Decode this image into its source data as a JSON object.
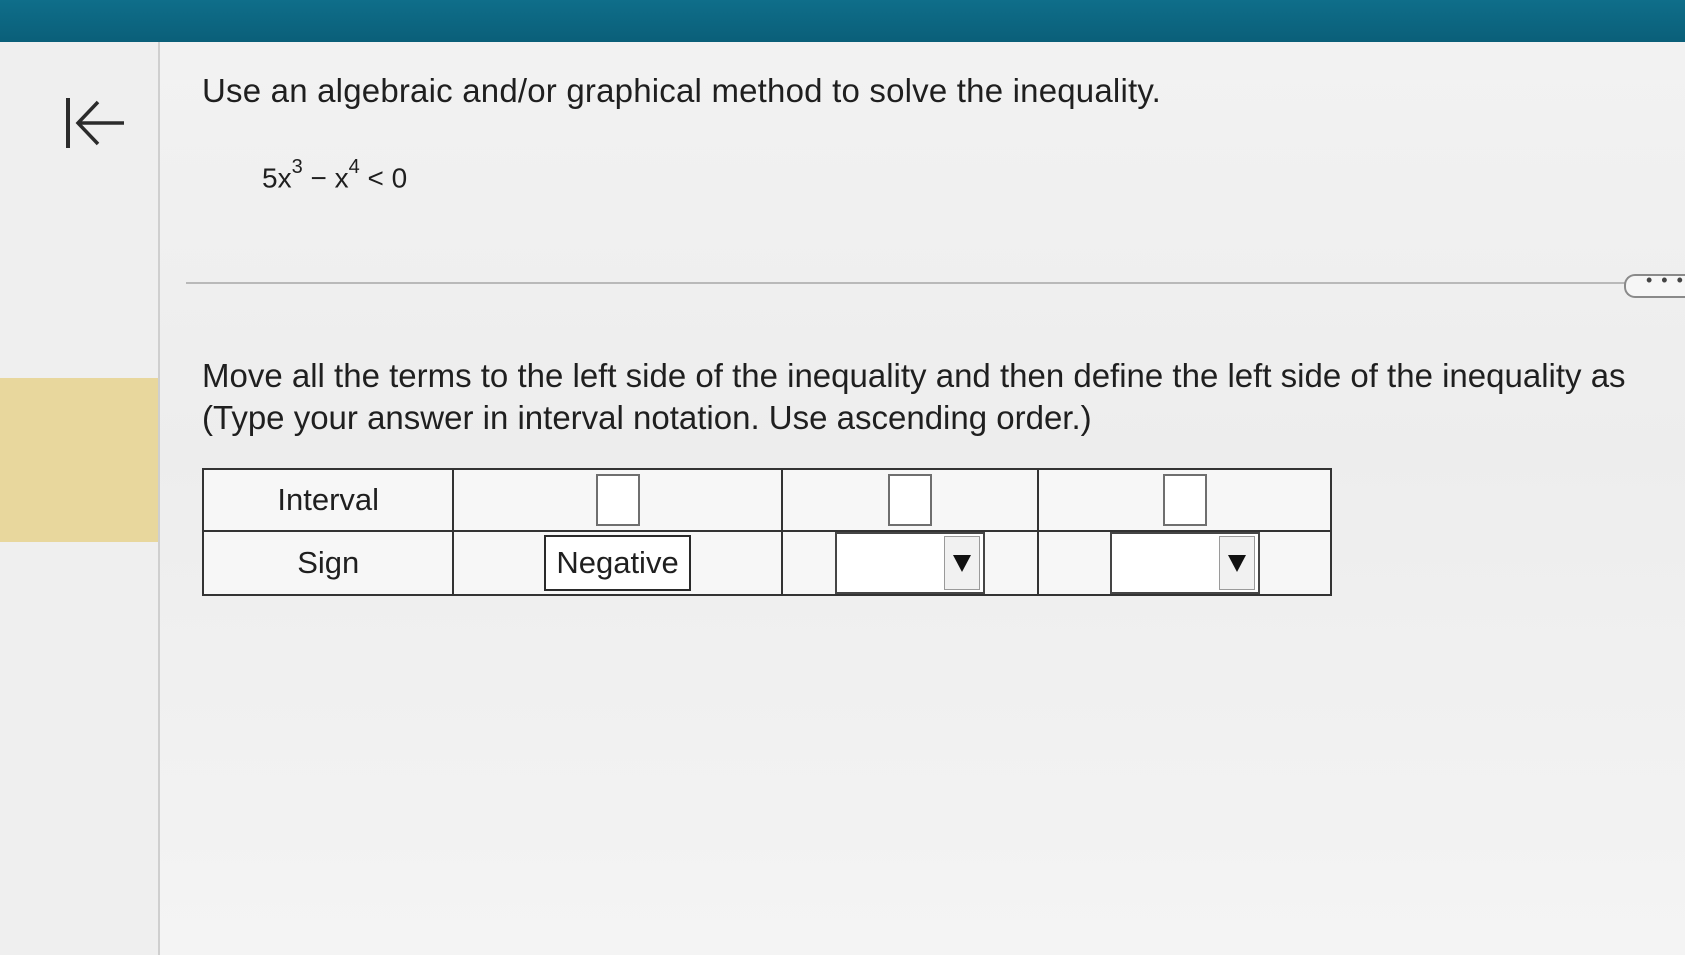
{
  "app": {
    "accent_color": "#0a5f79",
    "highlight_color": "#e8d79d"
  },
  "nav": {
    "back_icon": "arrow-left-to-bar-icon"
  },
  "question": {
    "instruction": "Use an algebraic and/or graphical method to solve the inequality.",
    "equation": {
      "term1_coef": "5x",
      "term1_exp": "3",
      "minus": "−",
      "term2_base": "x",
      "term2_exp": "4",
      "rhs": "< 0"
    }
  },
  "more_button": {
    "label": "• • •"
  },
  "part": {
    "line1": "Move all the terms to the left side of the inequality and then define the left side of the inequality as",
    "line2": "(Type your answer in interval notation. Use ascending order.)"
  },
  "table": {
    "row1_header": "Interval",
    "row2_header": "Sign",
    "sign1": "Negative",
    "interval_inputs": [
      "",
      "",
      ""
    ],
    "sign_selects": [
      "",
      ""
    ]
  }
}
